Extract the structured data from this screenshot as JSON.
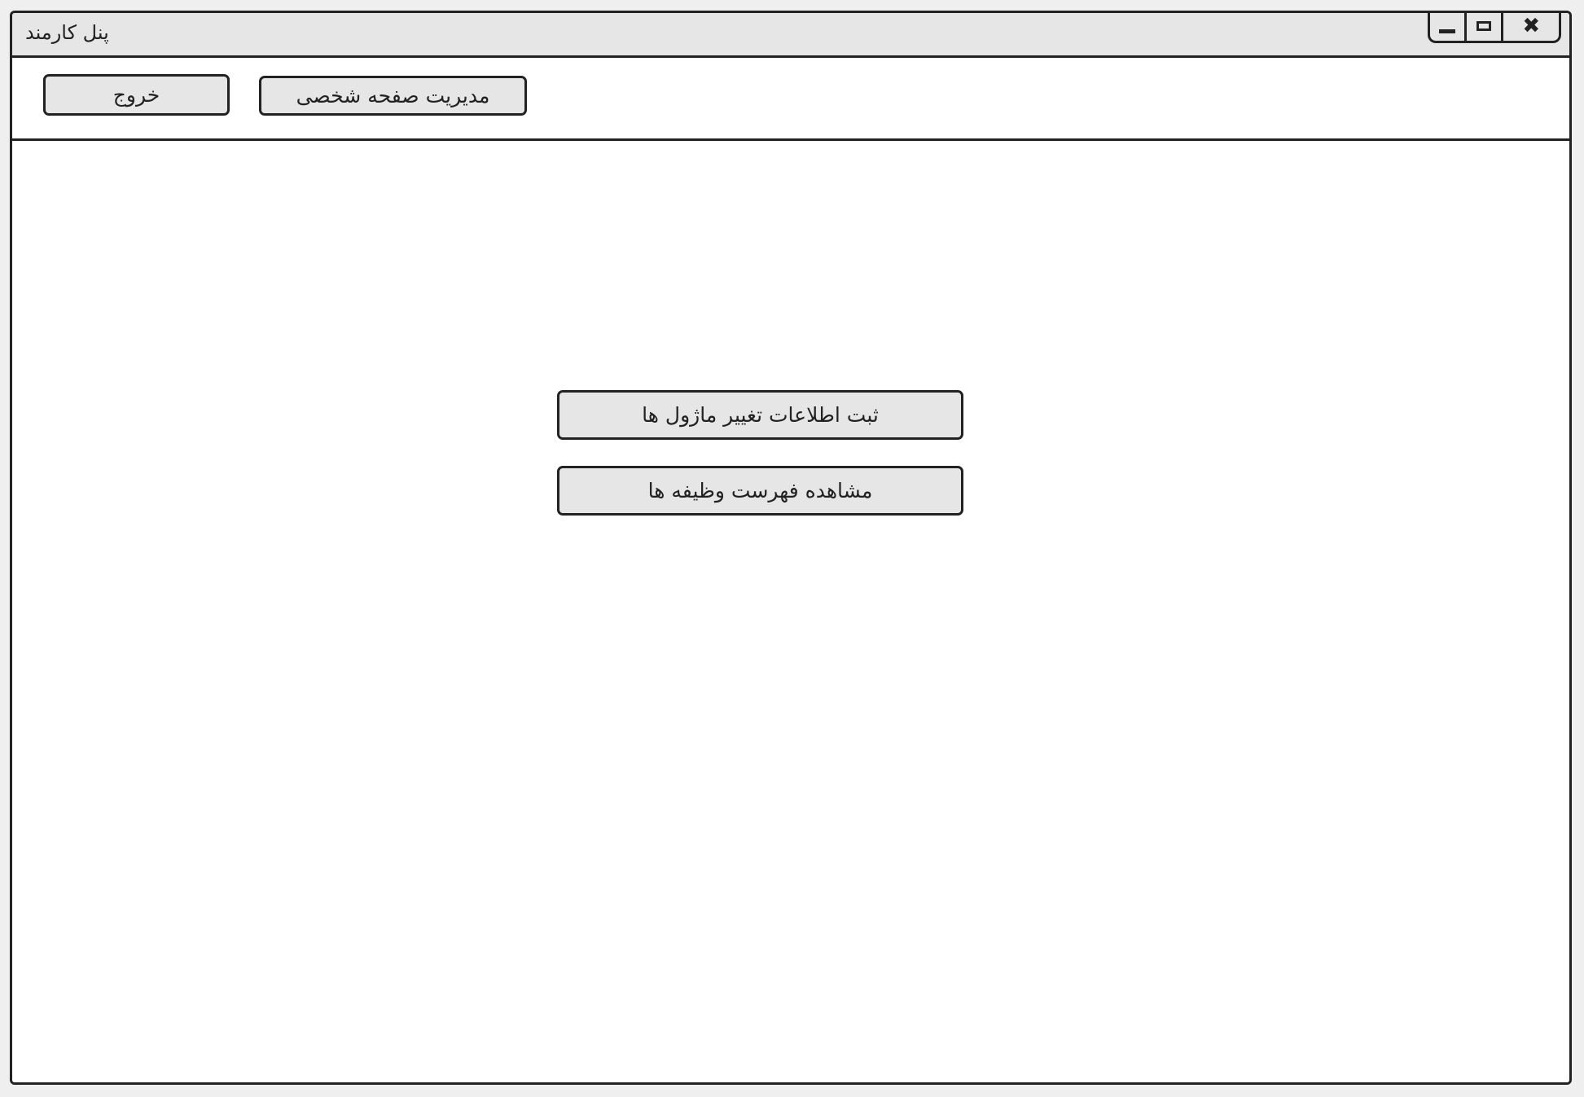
{
  "window": {
    "title": "پنل کارمند",
    "controls": {
      "minimize_icon": "minimize-icon",
      "maximize_icon": "maximize-icon",
      "close_icon": "close-icon",
      "close_glyph": "✖"
    }
  },
  "toolbar": {
    "exit_label": "خروج",
    "profile_label": "مدیریت صفحه شخصی"
  },
  "main": {
    "register_changes_label": "ثبت اطلاعات تغییر ماژول ها",
    "view_tasks_label": "مشاهده فهرست وظیفه ها"
  },
  "colors": {
    "chrome": "#e6e6e6",
    "border": "#222222",
    "background": "#ffffff"
  }
}
